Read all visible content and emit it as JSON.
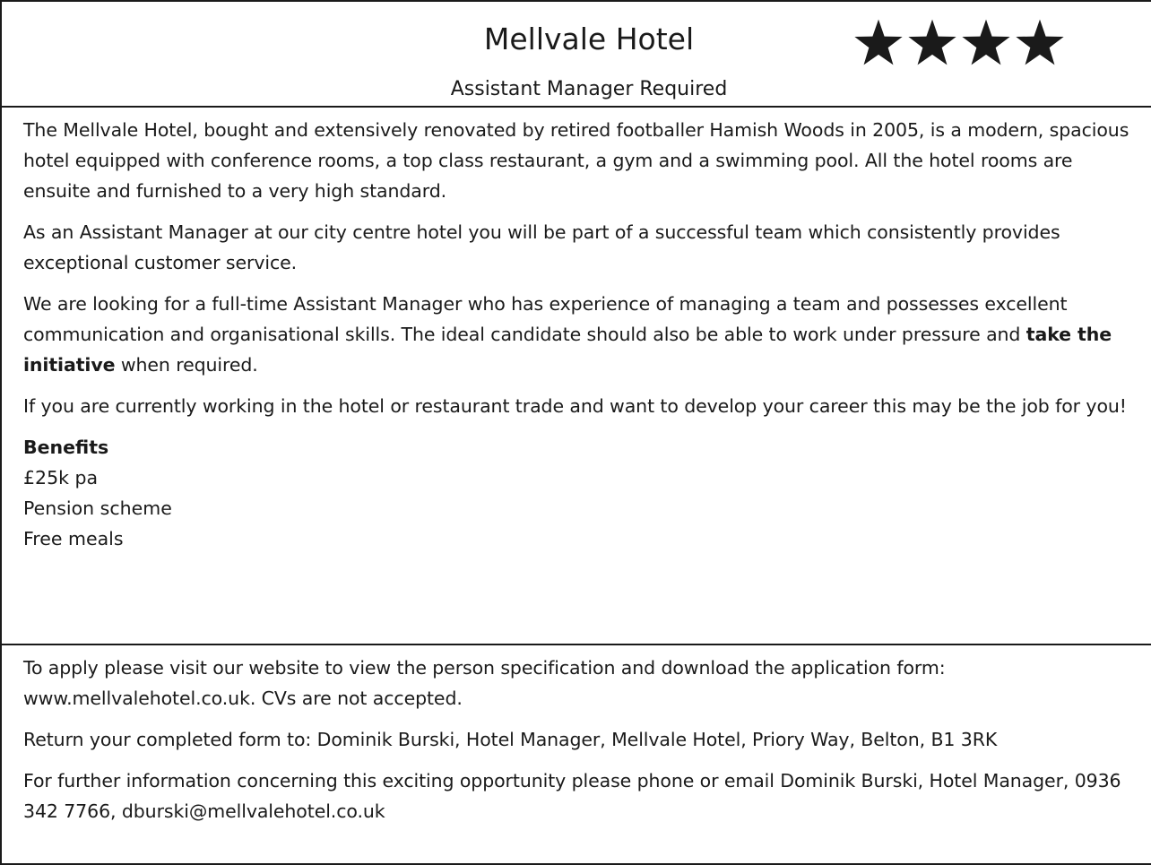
{
  "header": {
    "title": "Mellvale Hotel",
    "subtitle": "Assistant Manager Required",
    "star_rating": 4,
    "star_color": "#1a1a1a"
  },
  "body": {
    "para1": "The Mellvale Hotel, bought and extensively renovated by retired footballer Hamish Woods in 2005, is a modern, spacious hotel equipped with conference rooms, a top class restaurant, a gym and a swimming pool. All the hotel rooms are ensuite and furnished to a very high standard.",
    "para2": "As an Assistant Manager at our city centre hotel you will be part of a successful team which consistently provides exceptional customer service.",
    "para3_before": "We are looking for a full-time Assistant Manager who has experience of managing a team and possesses excellent communication and organisational skills. The ideal candidate should also be able to work under pressure and ",
    "para3_bold": "take the initiative",
    "para3_after": " when required.",
    "para4": "If you are currently working in the hotel or restaurant trade and want to develop your career this may be the job for you!",
    "benefits_heading": "Benefits",
    "benefits": [
      "£25k pa",
      "Pension scheme",
      "Free meals"
    ]
  },
  "footer": {
    "apply": "To apply please visit our website to view the person specification and download the application form: www.mellvalehotel.co.uk. CVs are not accepted.",
    "return": "Return your completed form to: Dominik Burski, Hotel Manager, Mellvale Hotel, Priory Way, Belton, B1 3RK",
    "info": "For further information concerning this exciting opportunity please phone or email Dominik Burski, Hotel Manager, 0936 342 7766, dburski@mellvalehotel.co.uk"
  }
}
